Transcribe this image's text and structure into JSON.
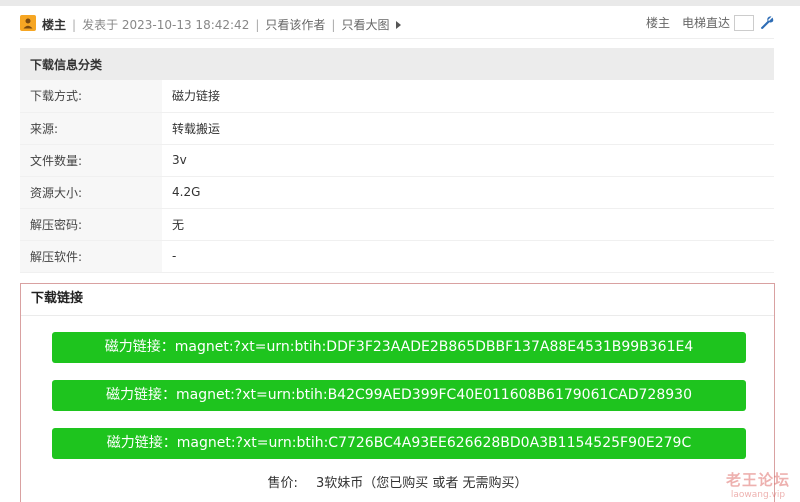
{
  "post_header": {
    "author": "楼主",
    "posted": "发表于 2023-10-13 18:42:42",
    "only_author": "只看该作者",
    "only_big_image": "只看大图",
    "floor_label": "楼主",
    "jump_label": "电梯直达"
  },
  "info": {
    "title": "下载信息分类",
    "rows": [
      {
        "key": "下载方式:",
        "value": "磁力链接"
      },
      {
        "key": "来源:",
        "value": "转载搬运"
      },
      {
        "key": "文件数量:",
        "value": "3v"
      },
      {
        "key": "资源大小:",
        "value": "4.2G"
      },
      {
        "key": "解压密码:",
        "value": "无"
      },
      {
        "key": "解压软件:",
        "value": "-"
      }
    ]
  },
  "download": {
    "title": "下载链接",
    "links": [
      "磁力链接：magnet:?xt=urn:btih:DDF3F23AADE2B865DBBF137A88E4531B99B361E4",
      "磁力链接：magnet:?xt=urn:btih:B42C99AED399FC40E011608B6179061CAD728930",
      "磁力链接：magnet:?xt=urn:btih:C7726BC4A93EE626628BD0A3B1154525F90E279C"
    ],
    "price_label": "售价:",
    "price_value": "3软妹币（您已购买 或者 无需购买）"
  },
  "watermark": {
    "line1": "老王论坛",
    "line2": "laowang.vip"
  },
  "colors": {
    "magnet_button": "#1ec41e",
    "download_border": "#d9a1a1",
    "avatar": "#f6a623"
  }
}
